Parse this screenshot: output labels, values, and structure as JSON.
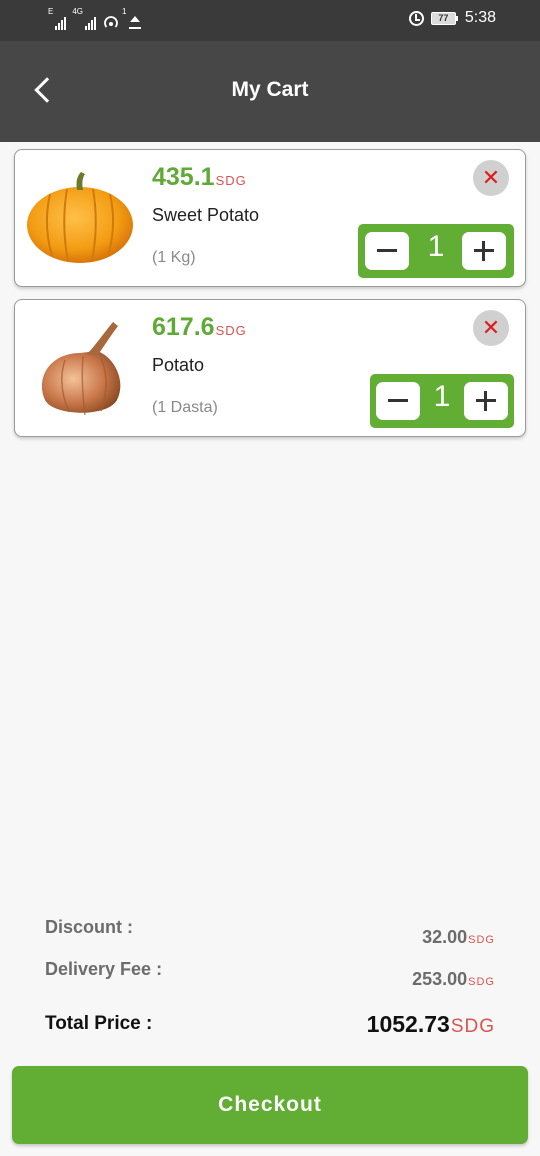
{
  "status_bar": {
    "net_tag_1": "E",
    "net_tag_2": "4G",
    "hotspot_count": "1",
    "battery": "77",
    "time": "5:38"
  },
  "header": {
    "title": "My Cart",
    "back_icon": "chevron-left-icon"
  },
  "cart": {
    "items": [
      {
        "price": "435.1",
        "currency": "SDG",
        "name": "Sweet Potato",
        "unit": "(1 Kg)",
        "quantity": "1",
        "image": "pumpkin-image",
        "remove_icon": "close-icon"
      },
      {
        "price": "617.6",
        "currency": "SDG",
        "name": "Potato",
        "unit": "(1 Dasta)",
        "quantity": "1",
        "image": "onion-image",
        "remove_icon": "close-icon"
      }
    ]
  },
  "summary": {
    "discount_label": "Discount :",
    "discount_value": "32.00",
    "delivery_label": "Delivery Fee :",
    "delivery_value": "253.00",
    "total_label": "Total Price :",
    "total_value": "1052.73",
    "currency": "SDG"
  },
  "checkout": {
    "label": "Checkout"
  },
  "colors": {
    "accent_green": "#62ad34",
    "price_green": "#5fa937",
    "currency_red": "#d9534f",
    "remove_red": "#e01b1b",
    "appbar": "#474747"
  }
}
